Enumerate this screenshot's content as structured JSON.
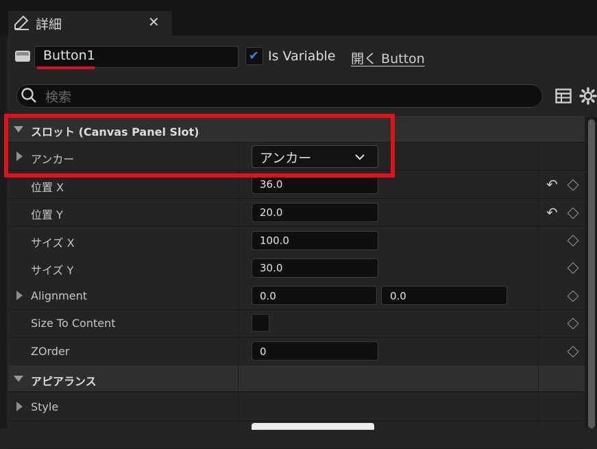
{
  "tab": {
    "title": "詳細",
    "close": "✕"
  },
  "header": {
    "name_value": "Button1",
    "is_variable_checked": true,
    "is_variable_label": "Is Variable",
    "open_link": "開く Button"
  },
  "search": {
    "placeholder": "検索"
  },
  "categories": {
    "slot": "スロット (Canvas Panel Slot)",
    "appearance": "アピアランス"
  },
  "properties": {
    "anchor": {
      "label": "アンカー",
      "value": "アンカー"
    },
    "pos_x": {
      "label": "位置 X",
      "value": "36.0"
    },
    "pos_y": {
      "label": "位置 Y",
      "value": "20.0"
    },
    "size_x": {
      "label": "サイズ X",
      "value": "100.0"
    },
    "size_y": {
      "label": "サイズ Y",
      "value": "30.0"
    },
    "alignment": {
      "label": "Alignment",
      "value_x": "0.0",
      "value_y": "0.0"
    },
    "size_to_content": {
      "label": "Size To Content",
      "checked": false
    },
    "zorder": {
      "label": "ZOrder",
      "value": "0"
    },
    "style": {
      "label": "Style"
    }
  },
  "colors": {
    "highlight_red": "#e0111b",
    "accent_blue": "#2f86e6"
  }
}
